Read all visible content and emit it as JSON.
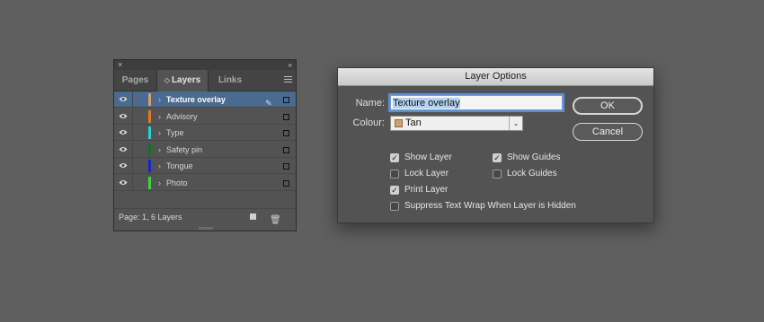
{
  "layers_panel": {
    "close_glyph": "×",
    "collapse_glyph": "‹‹",
    "tabs": [
      {
        "label": "Pages"
      },
      {
        "label": "Layers",
        "arrows": "◇"
      },
      {
        "label": "Links"
      }
    ],
    "layers": [
      {
        "name": "Texture overlay",
        "color": "#d4a06a",
        "selected": true
      },
      {
        "name": "Advisory",
        "color": "#e07b25",
        "selected": false
      },
      {
        "name": "Type",
        "color": "#2ad1d8",
        "selected": false
      },
      {
        "name": "Safety pin",
        "color": "#1b6b2a",
        "selected": false
      },
      {
        "name": "Tongue",
        "color": "#1a23c8",
        "selected": false
      },
      {
        "name": "Photo",
        "color": "#3cd63c",
        "selected": false
      }
    ],
    "chevron": "›",
    "pen_glyph": "✎",
    "status": "Page: 1, 6 Layers",
    "trash_glyph": "🗑"
  },
  "dialog": {
    "title": "Layer Options",
    "name_label": "Name:",
    "name_value": "Texture overlay",
    "colour_label": "Colour:",
    "colour_value": "Tan",
    "colour_swatch": "#d4a06a",
    "dropdown_glyph": "⌄",
    "ok_label": "OK",
    "cancel_label": "Cancel",
    "checkboxes": [
      {
        "label": "Show Layer",
        "checked": true
      },
      {
        "label": "Show Guides",
        "checked": true
      },
      {
        "label": "Lock Layer",
        "checked": false
      },
      {
        "label": "Lock Guides",
        "checked": false
      },
      {
        "label": "Print Layer",
        "checked": true
      },
      {
        "label": "Suppress Text Wrap When Layer is Hidden",
        "checked": false
      }
    ],
    "check_glyph": "✓"
  }
}
